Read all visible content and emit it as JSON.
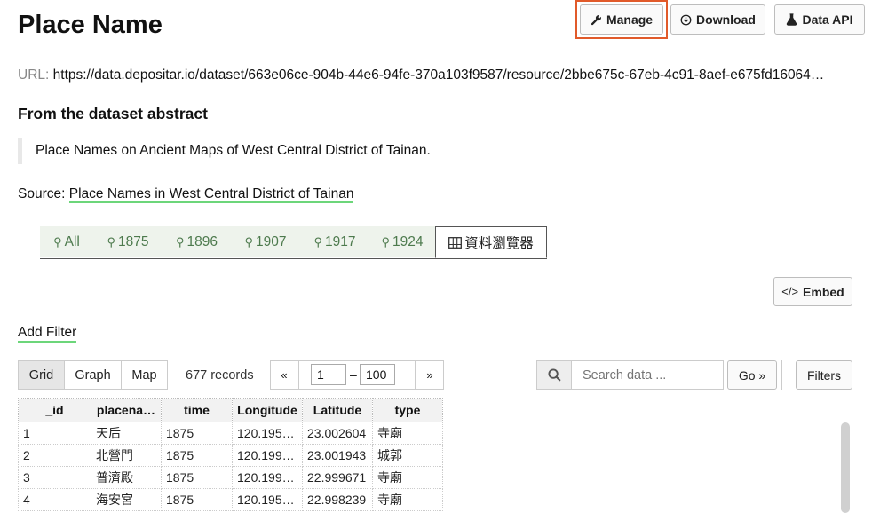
{
  "page": {
    "title": "Place Name"
  },
  "actions": {
    "manage": "Manage",
    "download": "Download",
    "data_api": "Data API",
    "embed": "Embed"
  },
  "url": {
    "label": "URL:",
    "value": "https://data.depositar.io/dataset/663e06ce-904b-44e6-94fe-370a103f9587/resource/2bbe675c-67eb-4c91-8aef-e675fd16064…"
  },
  "abstract": {
    "heading": "From the dataset abstract",
    "text": "Place Names on Ancient Maps of West Central District of Tainan."
  },
  "source": {
    "label": "Source:",
    "link": "Place Names in West Central District of Tainan"
  },
  "view_tabs": [
    {
      "label": "All",
      "icon": "map-marker-icon"
    },
    {
      "label": "1875",
      "icon": "map-marker-icon"
    },
    {
      "label": "1896",
      "icon": "map-marker-icon"
    },
    {
      "label": "1907",
      "icon": "map-marker-icon"
    },
    {
      "label": "1917",
      "icon": "map-marker-icon"
    },
    {
      "label": "1924",
      "icon": "map-marker-icon"
    },
    {
      "label": "資料瀏覽器",
      "icon": "table-icon",
      "active": true
    }
  ],
  "explorer": {
    "add_filter": "Add Filter",
    "view_modes": [
      "Grid",
      "Graph",
      "Map"
    ],
    "active_mode": "Grid",
    "records": "677 records",
    "pager": {
      "prev": "«",
      "from": "1",
      "sep": "–",
      "to": "100",
      "next": "»"
    },
    "search": {
      "placeholder": "Search data ...",
      "go": "Go »"
    },
    "filters": "Filters"
  },
  "table": {
    "columns": [
      "_id",
      "placena…",
      "time",
      "Longitude",
      "Latitude",
      "type"
    ],
    "rows": [
      [
        "1",
        "天后",
        "1875",
        "120.195…",
        "23.002604",
        "寺廟"
      ],
      [
        "2",
        "北營門",
        "1875",
        "120.199…",
        "23.001943",
        "城郭"
      ],
      [
        "3",
        "普濟殿",
        "1875",
        "120.199…",
        "22.999671",
        "寺廟"
      ],
      [
        "4",
        "海安宮",
        "1875",
        "120.195…",
        "22.998239",
        "寺廟"
      ]
    ]
  },
  "colors": {
    "accent_link_underline": "#6cd67a",
    "highlight_outline": "#e15a2a",
    "tab_text": "#4d7a4d"
  }
}
